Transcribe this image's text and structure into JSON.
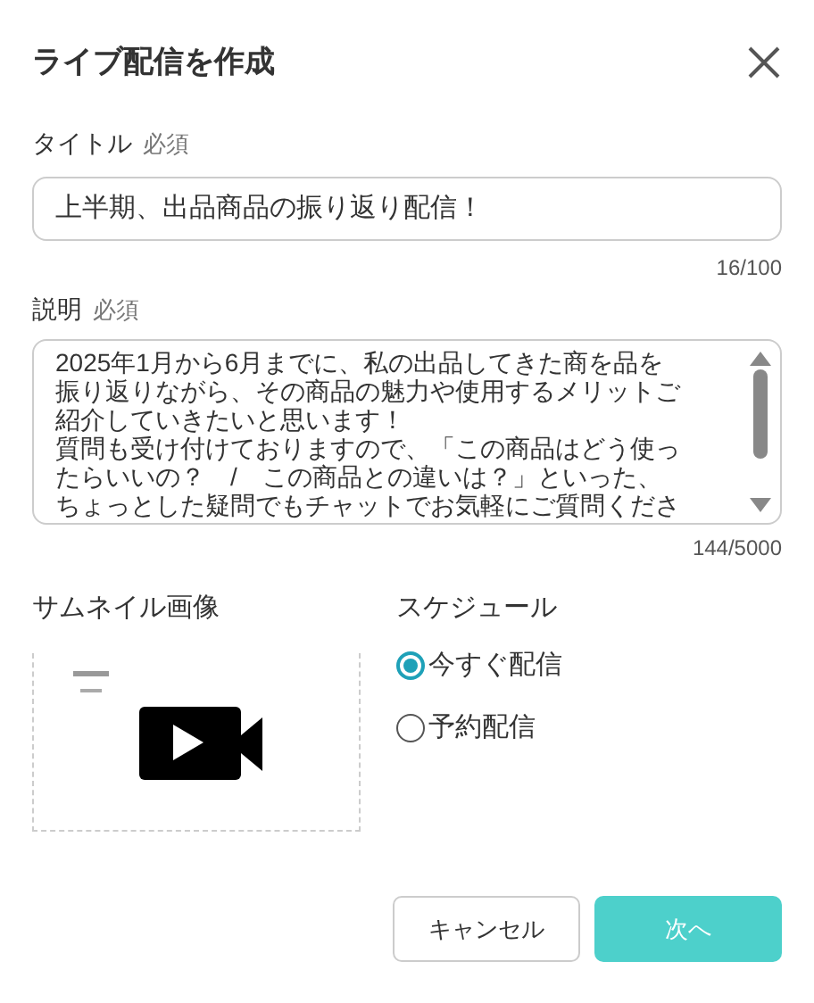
{
  "dialog": {
    "title": "ライブ配信を作成"
  },
  "title_field": {
    "label": "タイトル",
    "required": "必須",
    "value": "上半期、出品商品の振り返り配信！",
    "count": "16/100"
  },
  "description_field": {
    "label": "説明",
    "required": "必須",
    "lines": [
      "2025年1月から6月までに、私の出品してきた商を品を",
      "振り返りながら、その商品の魅力や使用するメリットご",
      "紹介していきたいと思います！",
      "質問も受け付けておりますので、「この商品はどう使っ",
      "たらいいの？　/　この商品との違いは？」といった、",
      "ちょっとした疑問でもチャットでお気軽にご質問くださ"
    ],
    "count": "144/5000"
  },
  "thumbnail": {
    "label": "サムネイル画像",
    "kind": "picture"
  },
  "schedule": {
    "label": "スケジュール",
    "options": [
      {
        "label": "今すぐ配信",
        "selected": true
      },
      {
        "label": "予約配信",
        "selected": false
      }
    ]
  },
  "buttons": {
    "cancel": "キャンセル",
    "next": "次へ"
  }
}
